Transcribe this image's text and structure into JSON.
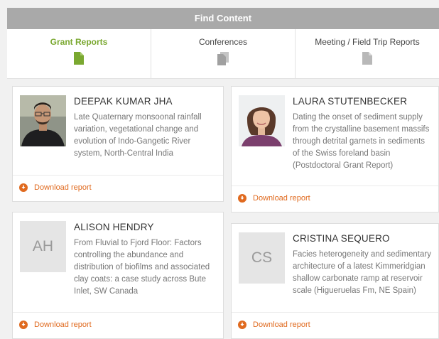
{
  "header": {
    "title": "Find Content"
  },
  "tabs": [
    {
      "label": "Grant Reports",
      "icon": "document-icon",
      "active": true
    },
    {
      "label": "Conferences",
      "icon": "stack-documents-icon",
      "active": false
    },
    {
      "label": "Meeting / Field Trip Reports",
      "icon": "document-icon",
      "active": false
    }
  ],
  "colors": {
    "accent_green": "#7aa830",
    "download_orange": "#e06a1f",
    "header_gray": "#a9a9a9"
  },
  "cards": [
    {
      "name": "DEEPAK KUMAR JHA",
      "avatar": "photo",
      "description": "Late Quaternary monsoonal rainfall variation, vegetational change and evolution of Indo-Gangetic River system, North-Central India",
      "download_label": "Download report"
    },
    {
      "name": "LAURA STUTENBECKER",
      "avatar": "photo",
      "description": "Dating the onset of sediment supply from the crystalline basement massifs through detrital garnets in sediments of the Swiss foreland basin (Postdoctoral Grant Report)",
      "download_label": "Download report"
    },
    {
      "name": "ALISON HENDRY",
      "avatar": "initials",
      "initials": "AH",
      "description": "From Fluvial to Fjord Floor: Factors controlling the abundance and distribution of biofilms and associated clay coats: a case study across Bute Inlet, SW Canada",
      "download_label": "Download report"
    },
    {
      "name": "CRISTINA SEQUERO",
      "avatar": "initials",
      "initials": "CS",
      "description": "Facies heterogeneity and sedimentary architecture of a latest Kimmeridgian shallow carbonate ramp at reservoir scale (Higueruelas Fm, NE Spain)",
      "download_label": "Download report"
    }
  ]
}
